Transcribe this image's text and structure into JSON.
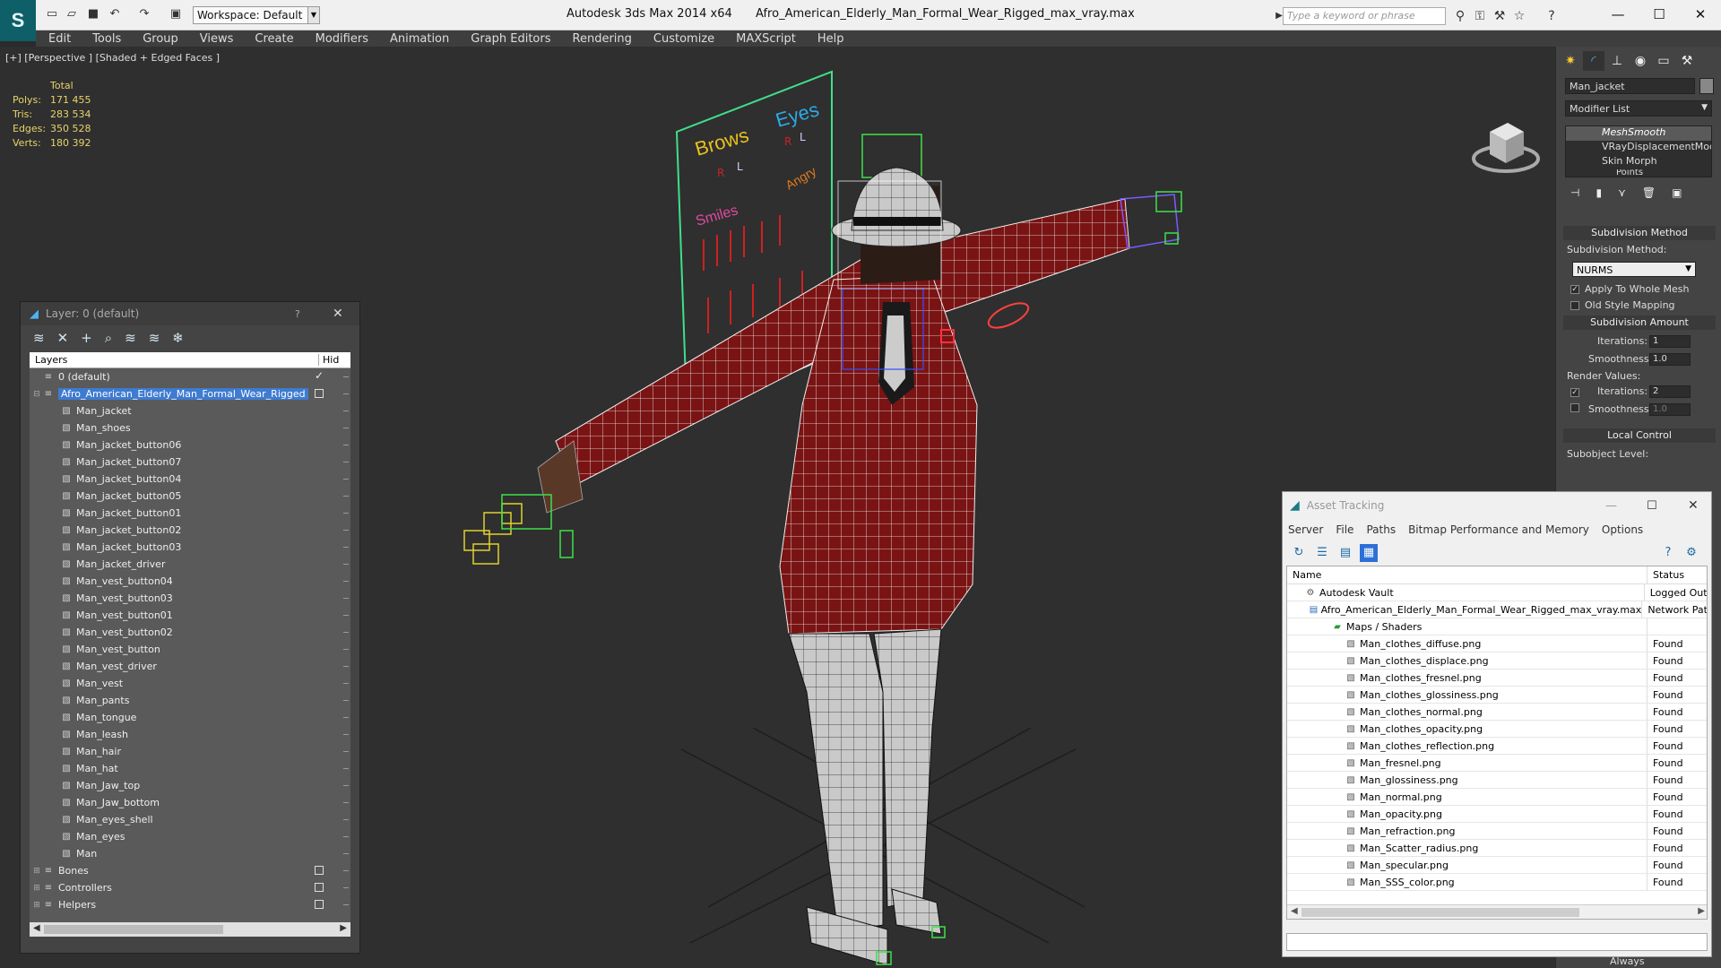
{
  "window": {
    "app_title": "Autodesk 3ds Max  2014 x64",
    "file_name": "Afro_American_Elderly_Man_Formal_Wear_Rigged_max_vray.max",
    "workspace_label": "Workspace: Default",
    "search_placeholder": "Type a keyword or phrase"
  },
  "menu": [
    "Edit",
    "Tools",
    "Group",
    "Views",
    "Create",
    "Modifiers",
    "Animation",
    "Graph Editors",
    "Rendering",
    "Customize",
    "MAXScript",
    "Help"
  ],
  "viewport": {
    "label": "[+] [Perspective ] [Shaded + Edged Faces ]",
    "stats_header": "Total",
    "stats": [
      {
        "key": "Polys:",
        "value": "171 455"
      },
      {
        "key": "Tris:",
        "value": "283 534"
      },
      {
        "key": "Edges:",
        "value": "350 528"
      },
      {
        "key": "Verts:",
        "value": "180 392"
      }
    ],
    "face_ui": {
      "brows": "Brows",
      "eyes": "Eyes",
      "smiles": "Smiles",
      "angry": "Angry",
      "r": "R",
      "l": "L"
    }
  },
  "command_panel": {
    "object_name": "Man_jacket",
    "modifier_list": "Modifier List",
    "stack": [
      "MeshSmooth",
      "VRayDisplacementMod",
      "Skin Morph",
      "Points"
    ],
    "subdivision_method_header": "Subdivision Method",
    "subdivision_method_label": "Subdivision Method:",
    "subdivision_method_value": "NURMS",
    "apply_whole_mesh": "Apply To Whole Mesh",
    "old_style_mapping": "Old Style Mapping",
    "subdivision_amount_header": "Subdivision Amount",
    "iterations_label": "Iterations:",
    "iterations_value": "1",
    "smoothness_label": "Smoothness:",
    "smoothness_value": "1.0",
    "render_values_label": "Render Values:",
    "render_iterations_label": "Iterations:",
    "render_iterations_value": "2",
    "render_smoothness_label": "Smoothness:",
    "render_smoothness_value": "1.0",
    "local_control_header": "Local Control",
    "subobject_level_label": "Subobject Level:",
    "always_label": "Always"
  },
  "layer_dialog": {
    "title": "Layer: 0 (default)",
    "help": "?",
    "column_layers": "Layers",
    "column_hide": "Hid",
    "rows": [
      {
        "name": "0 (default)",
        "level": 0,
        "type": "layer",
        "mark": "tick"
      },
      {
        "name": "Afro_American_Elderly_Man_Formal_Wear_Rigged",
        "level": 0,
        "type": "layer",
        "mark": "box",
        "selected": true,
        "expanded": true
      },
      {
        "name": "Man_jacket",
        "level": 1,
        "type": "obj"
      },
      {
        "name": "Man_shoes",
        "level": 1,
        "type": "obj"
      },
      {
        "name": "Man_jacket_button06",
        "level": 1,
        "type": "obj"
      },
      {
        "name": "Man_jacket_button07",
        "level": 1,
        "type": "obj"
      },
      {
        "name": "Man_jacket_button04",
        "level": 1,
        "type": "obj"
      },
      {
        "name": "Man_jacket_button05",
        "level": 1,
        "type": "obj"
      },
      {
        "name": "Man_jacket_button01",
        "level": 1,
        "type": "obj"
      },
      {
        "name": "Man_jacket_button02",
        "level": 1,
        "type": "obj"
      },
      {
        "name": "Man_jacket_button03",
        "level": 1,
        "type": "obj"
      },
      {
        "name": "Man_jacket_driver",
        "level": 1,
        "type": "obj"
      },
      {
        "name": "Man_vest_button04",
        "level": 1,
        "type": "obj"
      },
      {
        "name": "Man_vest_button03",
        "level": 1,
        "type": "obj"
      },
      {
        "name": "Man_vest_button01",
        "level": 1,
        "type": "obj"
      },
      {
        "name": "Man_vest_button02",
        "level": 1,
        "type": "obj"
      },
      {
        "name": "Man_vest_button",
        "level": 1,
        "type": "obj"
      },
      {
        "name": "Man_vest_driver",
        "level": 1,
        "type": "obj"
      },
      {
        "name": "Man_vest",
        "level": 1,
        "type": "obj"
      },
      {
        "name": "Man_pants",
        "level": 1,
        "type": "obj"
      },
      {
        "name": "Man_tongue",
        "level": 1,
        "type": "obj"
      },
      {
        "name": "Man_leash",
        "level": 1,
        "type": "obj"
      },
      {
        "name": "Man_hair",
        "level": 1,
        "type": "obj"
      },
      {
        "name": "Man_hat",
        "level": 1,
        "type": "obj"
      },
      {
        "name": "Man_Jaw_top",
        "level": 1,
        "type": "obj"
      },
      {
        "name": "Man_Jaw_bottom",
        "level": 1,
        "type": "obj"
      },
      {
        "name": "Man_eyes_shell",
        "level": 1,
        "type": "obj"
      },
      {
        "name": "Man_eyes",
        "level": 1,
        "type": "obj"
      },
      {
        "name": "Man",
        "level": 1,
        "type": "obj"
      },
      {
        "name": "Bones",
        "level": 0,
        "type": "layer",
        "mark": "box",
        "collapsed": true
      },
      {
        "name": "Controllers",
        "level": 0,
        "type": "layer",
        "mark": "box",
        "collapsed": true
      },
      {
        "name": "Helpers",
        "level": 0,
        "type": "layer",
        "mark": "box",
        "collapsed": true
      }
    ]
  },
  "asset_tracking": {
    "title": "Asset Tracking",
    "menu": [
      "Server",
      "File",
      "Paths",
      "Bitmap Performance and Memory",
      "Options"
    ],
    "col_name": "Name",
    "col_status": "Status",
    "rows": [
      {
        "name": "Autodesk Vault",
        "level": 1,
        "status": "Logged Out"
      },
      {
        "name": "Afro_American_Elderly_Man_Formal_Wear_Rigged_max_vray.max",
        "level": 2,
        "status": "Network Pat"
      },
      {
        "name": "Maps / Shaders",
        "level": 3,
        "status": ""
      },
      {
        "name": "Man_clothes_diffuse.png",
        "level": 4,
        "status": "Found"
      },
      {
        "name": "Man_clothes_displace.png",
        "level": 4,
        "status": "Found"
      },
      {
        "name": "Man_clothes_fresnel.png",
        "level": 4,
        "status": "Found"
      },
      {
        "name": "Man_clothes_glossiness.png",
        "level": 4,
        "status": "Found"
      },
      {
        "name": "Man_clothes_normal.png",
        "level": 4,
        "status": "Found"
      },
      {
        "name": "Man_clothes_opacity.png",
        "level": 4,
        "status": "Found"
      },
      {
        "name": "Man_clothes_reflection.png",
        "level": 4,
        "status": "Found"
      },
      {
        "name": "Man_fresnel.png",
        "level": 4,
        "status": "Found"
      },
      {
        "name": "Man_glossiness.png",
        "level": 4,
        "status": "Found"
      },
      {
        "name": "Man_normal.png",
        "level": 4,
        "status": "Found"
      },
      {
        "name": "Man_opacity.png",
        "level": 4,
        "status": "Found"
      },
      {
        "name": "Man_refraction.png",
        "level": 4,
        "status": "Found"
      },
      {
        "name": "Man_Scatter_radius.png",
        "level": 4,
        "status": "Found"
      },
      {
        "name": "Man_specular.png",
        "level": 4,
        "status": "Found"
      },
      {
        "name": "Man_SSS_color.png",
        "level": 4,
        "status": "Found"
      }
    ]
  }
}
